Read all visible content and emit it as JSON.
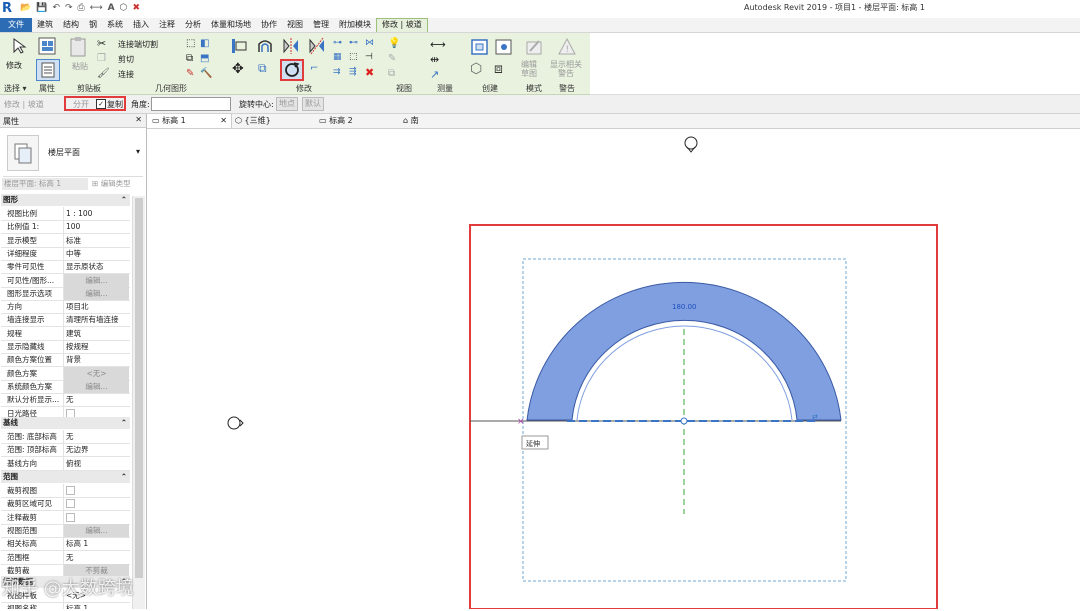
{
  "window": {
    "title": "Autodesk Revit 2019 - 项目1 - 楼层平面: 标高 1"
  },
  "menu": [
    "文件",
    "建筑",
    "结构",
    "钢",
    "系统",
    "插入",
    "注释",
    "分析",
    "体量和场地",
    "协作",
    "视图",
    "管理",
    "附加模块",
    "修改 | 坡道"
  ],
  "ribbon": {
    "groups": [
      "选择 ▾",
      "属性",
      "剪贴板",
      "几何图形",
      "修改",
      "视图",
      "测量",
      "创建",
      "模式",
      "警告"
    ],
    "modify_label": "修改",
    "paste_label": "粘贴",
    "join_cut_label": "连接端切割",
    "cut_label": "剪切",
    "join_label": "连接",
    "edit_sketch_label": "编辑\n草图",
    "show_related_label": "显示相关\n警告"
  },
  "options": {
    "modify_context": "修改 | 坡道",
    "disjoin": "分开",
    "copy_checked": true,
    "copy_label": "复制",
    "angle_label": "角度:",
    "angle_value": "",
    "rotate_center_label": "旋转中心:",
    "place_btn": "地点",
    "default_btn": "默认"
  },
  "tabs": [
    {
      "label": "标高 1",
      "active": true
    },
    {
      "label": "{三维}",
      "active": false
    },
    {
      "label": "标高 2",
      "active": false
    },
    {
      "label": "南",
      "active": false
    }
  ],
  "properties": {
    "title": "属性",
    "type_name": "楼层平面",
    "selector": "楼层平面: 标高 1",
    "edit_type": "编辑类型",
    "categories": [
      {
        "name": "图形",
        "rows": [
          [
            "视图比例",
            "1 : 100",
            false
          ],
          [
            "比例值 1:",
            "100",
            false
          ],
          [
            "显示模型",
            "标准",
            false
          ],
          [
            "详细程度",
            "中等",
            false
          ],
          [
            "零件可见性",
            "显示原状态",
            false
          ],
          [
            "可见性/图形...",
            "编辑...",
            true
          ],
          [
            "图形显示选项",
            "编辑...",
            true
          ],
          [
            "方向",
            "项目北",
            false
          ],
          [
            "墙连接显示",
            "清理所有墙连接",
            false
          ],
          [
            "规程",
            "建筑",
            false
          ],
          [
            "显示隐藏线",
            "按规程",
            false
          ],
          [
            "颜色方案位置",
            "背景",
            false
          ],
          [
            "颜色方案",
            "<无>",
            true
          ],
          [
            "系统颜色方案",
            "编辑...",
            true
          ],
          [
            "默认分析显示...",
            "无",
            false
          ],
          [
            "日光路径",
            "",
            false
          ]
        ]
      },
      {
        "name": "基线",
        "rows": [
          [
            "范围: 底部标高",
            "无",
            false
          ],
          [
            "范围: 顶部标高",
            "无边界",
            false
          ],
          [
            "基线方向",
            "俯视",
            false
          ]
        ]
      },
      {
        "name": "范围",
        "rows": [
          [
            "裁剪视图",
            "",
            false
          ],
          [
            "裁剪区域可见",
            "",
            false
          ],
          [
            "注释裁剪",
            "",
            false
          ],
          [
            "视图范围",
            "编辑...",
            true
          ],
          [
            "相关标高",
            "标高 1",
            false
          ],
          [
            "范围框",
            "无",
            false
          ],
          [
            "截剪裁",
            "不剪裁",
            true
          ]
        ]
      },
      {
        "name": "标识数据",
        "rows": [
          [
            "视图样板",
            "<无>",
            false
          ],
          [
            "视图名称",
            "标高 1",
            false
          ]
        ]
      }
    ]
  },
  "canvas": {
    "dimension_label": "180.00",
    "tooltip": "延伸"
  },
  "watermark": "知乎 @大数跨境",
  "colors": {
    "ramp_fill": "#7f9fe0",
    "highlight_red": "#e23b3b",
    "ribbon_bg": "#e8f2df"
  }
}
